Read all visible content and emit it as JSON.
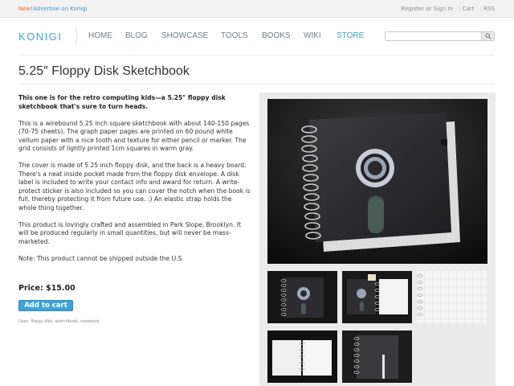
{
  "topbar": {
    "new_label": "New!",
    "advertise_label": "Advertise on Konigi",
    "register_label": "Register or Sign In",
    "cart_label": "Cart",
    "rss_label": "RSS"
  },
  "nav": {
    "logo": "KONIGI",
    "items": [
      {
        "label": "HOME"
      },
      {
        "label": "BLOG"
      },
      {
        "label": "SHOWCASE"
      },
      {
        "label": "TOOLS"
      },
      {
        "label": "BOOKS"
      },
      {
        "label": "WIKI"
      },
      {
        "label": "STORE"
      }
    ],
    "active_item": "STORE",
    "search_value": "",
    "accent_color": "#3fa3d8"
  },
  "page": {
    "title": "5.25″ Floppy Disk Sketchbook",
    "lead": "This one is for the retro computing kids—a 5.25\" floppy disk sketchbook that's sure to turn heads.",
    "paragraphs": [
      "This is a wirebound 5.25 inch square sketchbook with about 140-150 pages (70-75 sheets). The graph paper pages are printed on 60 pound white vellum paper with a nice tooth and texture for either pencil or marker. The grid consists of lightly printed 1cm squares in warm gray.",
      "The cover is made of 5.25 inch floppy disk, and the back is a heavy board. There's a neat inside pocket made from the floppy disk envelope. A disk label is included to write your contact info and award for return. A write-protect sticker is also included so you can cover the notch when the book is full, thereby protecting it from future use. :) An elastic strap holds the whole thing together.",
      "This product is lovingly crafted and assembled in Park Slope, Brooklyn. It will be produced regularly in small quantities, but will never be mass-marketed.",
      "Note: This product cannot be shipped outside the U.S."
    ],
    "price": "Price: $15.00",
    "add_to_cart_label": "Add to cart",
    "tags": "Uses: floppy disk, sketchbook, notebook"
  }
}
